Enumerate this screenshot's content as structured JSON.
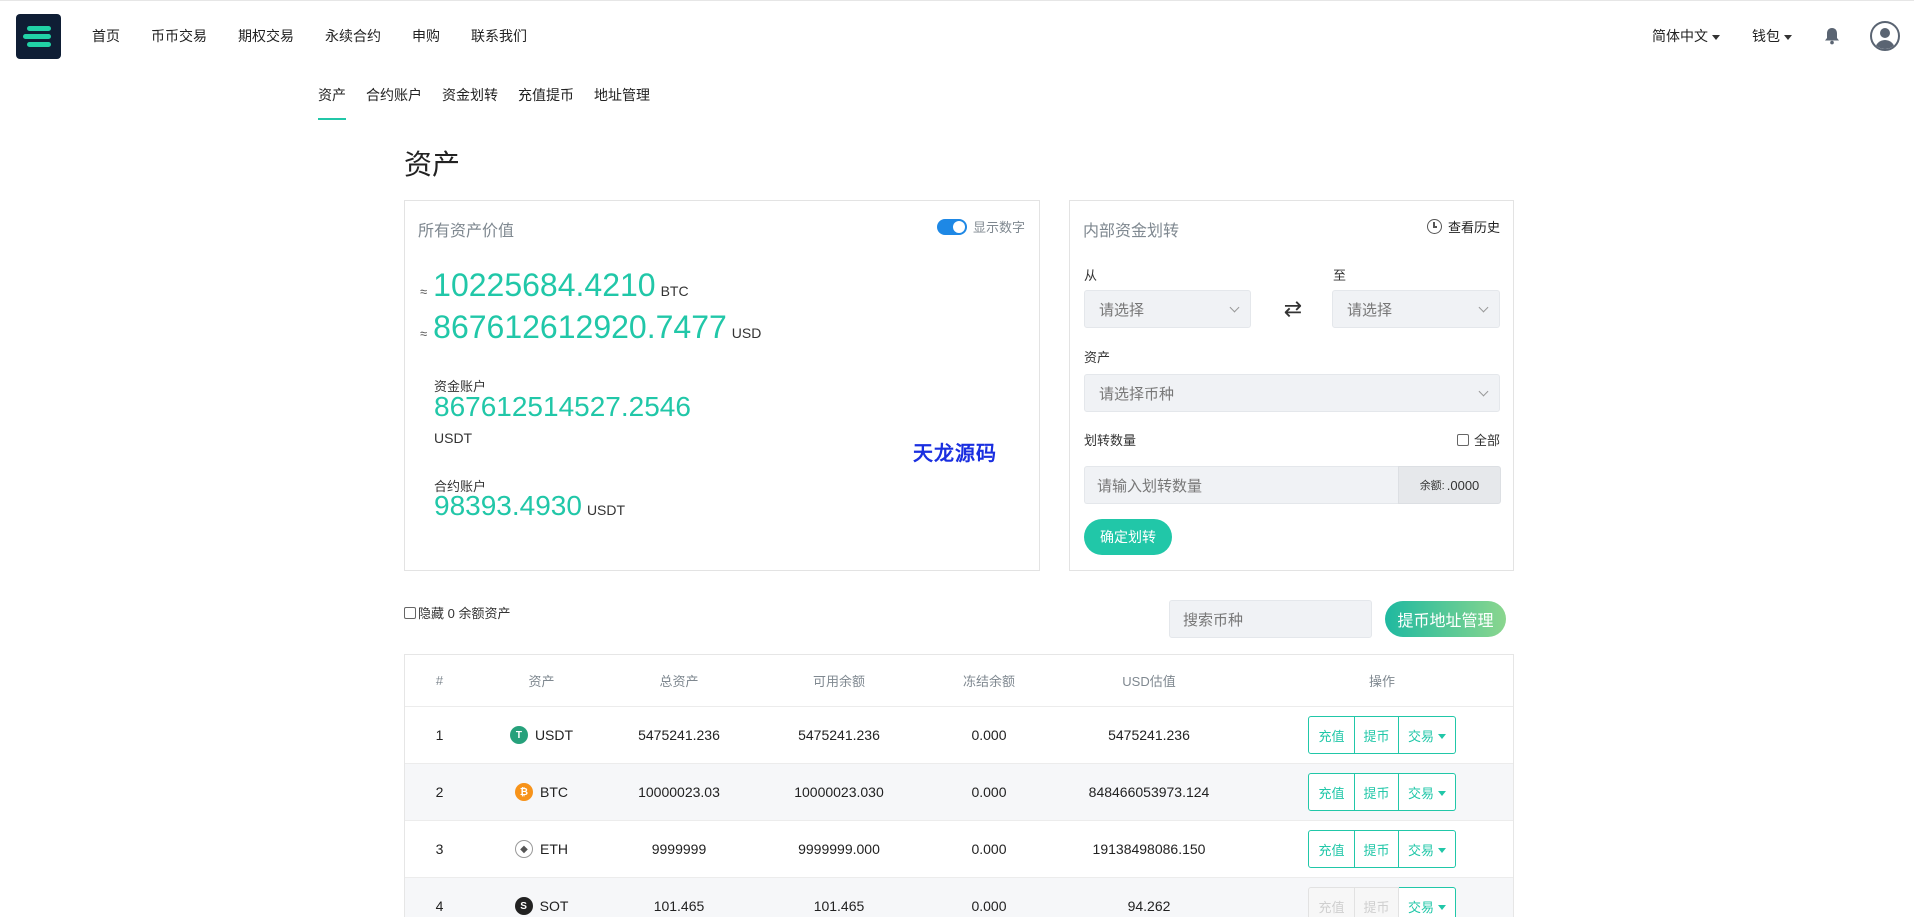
{
  "nav": {
    "items": [
      "首页",
      "币币交易",
      "期权交易",
      "永续合约",
      "申购",
      "联系我们"
    ],
    "lang": "简体中文",
    "wallet": "钱包"
  },
  "subnav": {
    "items": [
      "资产",
      "合约账户",
      "资金划转",
      "充值提币",
      "地址管理"
    ],
    "active_index": 0
  },
  "page_title": "资产",
  "assets": {
    "head": "所有资产价值",
    "toggle_label": "显示数字",
    "toggle_on": true,
    "approx": "≈",
    "btc_value": "10225684.4210",
    "btc_unit": "BTC",
    "usd_value": "867612612920.7477",
    "usd_unit": "USD",
    "fund_label": "资金账户",
    "fund_value": "867612514527.2546",
    "fund_unit": "USDT",
    "contract_label": "合约账户",
    "contract_value": "98393.4930",
    "contract_unit": "USDT",
    "watermark": "天龙源码"
  },
  "transfer": {
    "head": "内部资金划转",
    "history": "查看历史",
    "from_label": "从",
    "to_label": "至",
    "from_placeholder": "请选择",
    "to_placeholder": "请选择",
    "asset_label": "资产",
    "asset_placeholder": "请选择币种",
    "amount_label": "划转数量",
    "all_label": "全部",
    "amount_placeholder": "请输入划转数量",
    "balance_prefix": "余额:",
    "balance_value": ".0000",
    "confirm": "确定划转"
  },
  "filters": {
    "hide_zero": "隐藏 0 余额资产",
    "search_placeholder": "搜索币种",
    "addr_button": "提币地址管理"
  },
  "table": {
    "headers": [
      "#",
      "资产",
      "总资产",
      "可用余额",
      "冻结余额",
      "USD估值",
      "操作"
    ],
    "rows": [
      {
        "idx": "1",
        "coin": "USDT",
        "total": "5475241.236",
        "available": "5475241.236",
        "frozen": "0.000",
        "usd": "5475241.236",
        "icon_color": "#26a17b",
        "icon_glyph": "T",
        "disabled": false
      },
      {
        "idx": "2",
        "coin": "BTC",
        "total": "10000023.03",
        "available": "10000023.030",
        "frozen": "0.000",
        "usd": "848466053973.124",
        "icon_color": "#f7931a",
        "icon_glyph": "₿",
        "disabled": false
      },
      {
        "idx": "3",
        "coin": "ETH",
        "total": "9999999",
        "available": "9999999.000",
        "frozen": "0.000",
        "usd": "19138498086.150",
        "icon_color": "#8a8a8a",
        "icon_glyph": "◆",
        "disabled": false
      },
      {
        "idx": "4",
        "coin": "SOT",
        "total": "101.465",
        "available": "101.465",
        "frozen": "0.000",
        "usd": "94.262",
        "icon_color": "#222222",
        "icon_glyph": "S",
        "disabled": true
      }
    ],
    "actions": {
      "deposit": "充值",
      "withdraw": "提币",
      "trade": "交易"
    }
  }
}
